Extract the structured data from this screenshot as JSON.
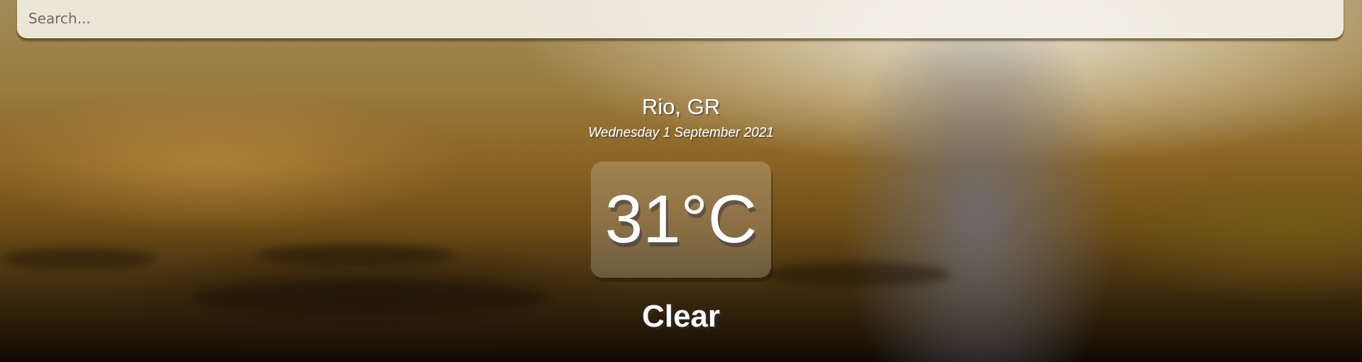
{
  "search": {
    "placeholder": "Search..."
  },
  "location": {
    "name": "Rio, GR",
    "date": "Wednesday 1 September 2021"
  },
  "weather": {
    "temperature": "31°C",
    "condition": "Clear"
  }
}
